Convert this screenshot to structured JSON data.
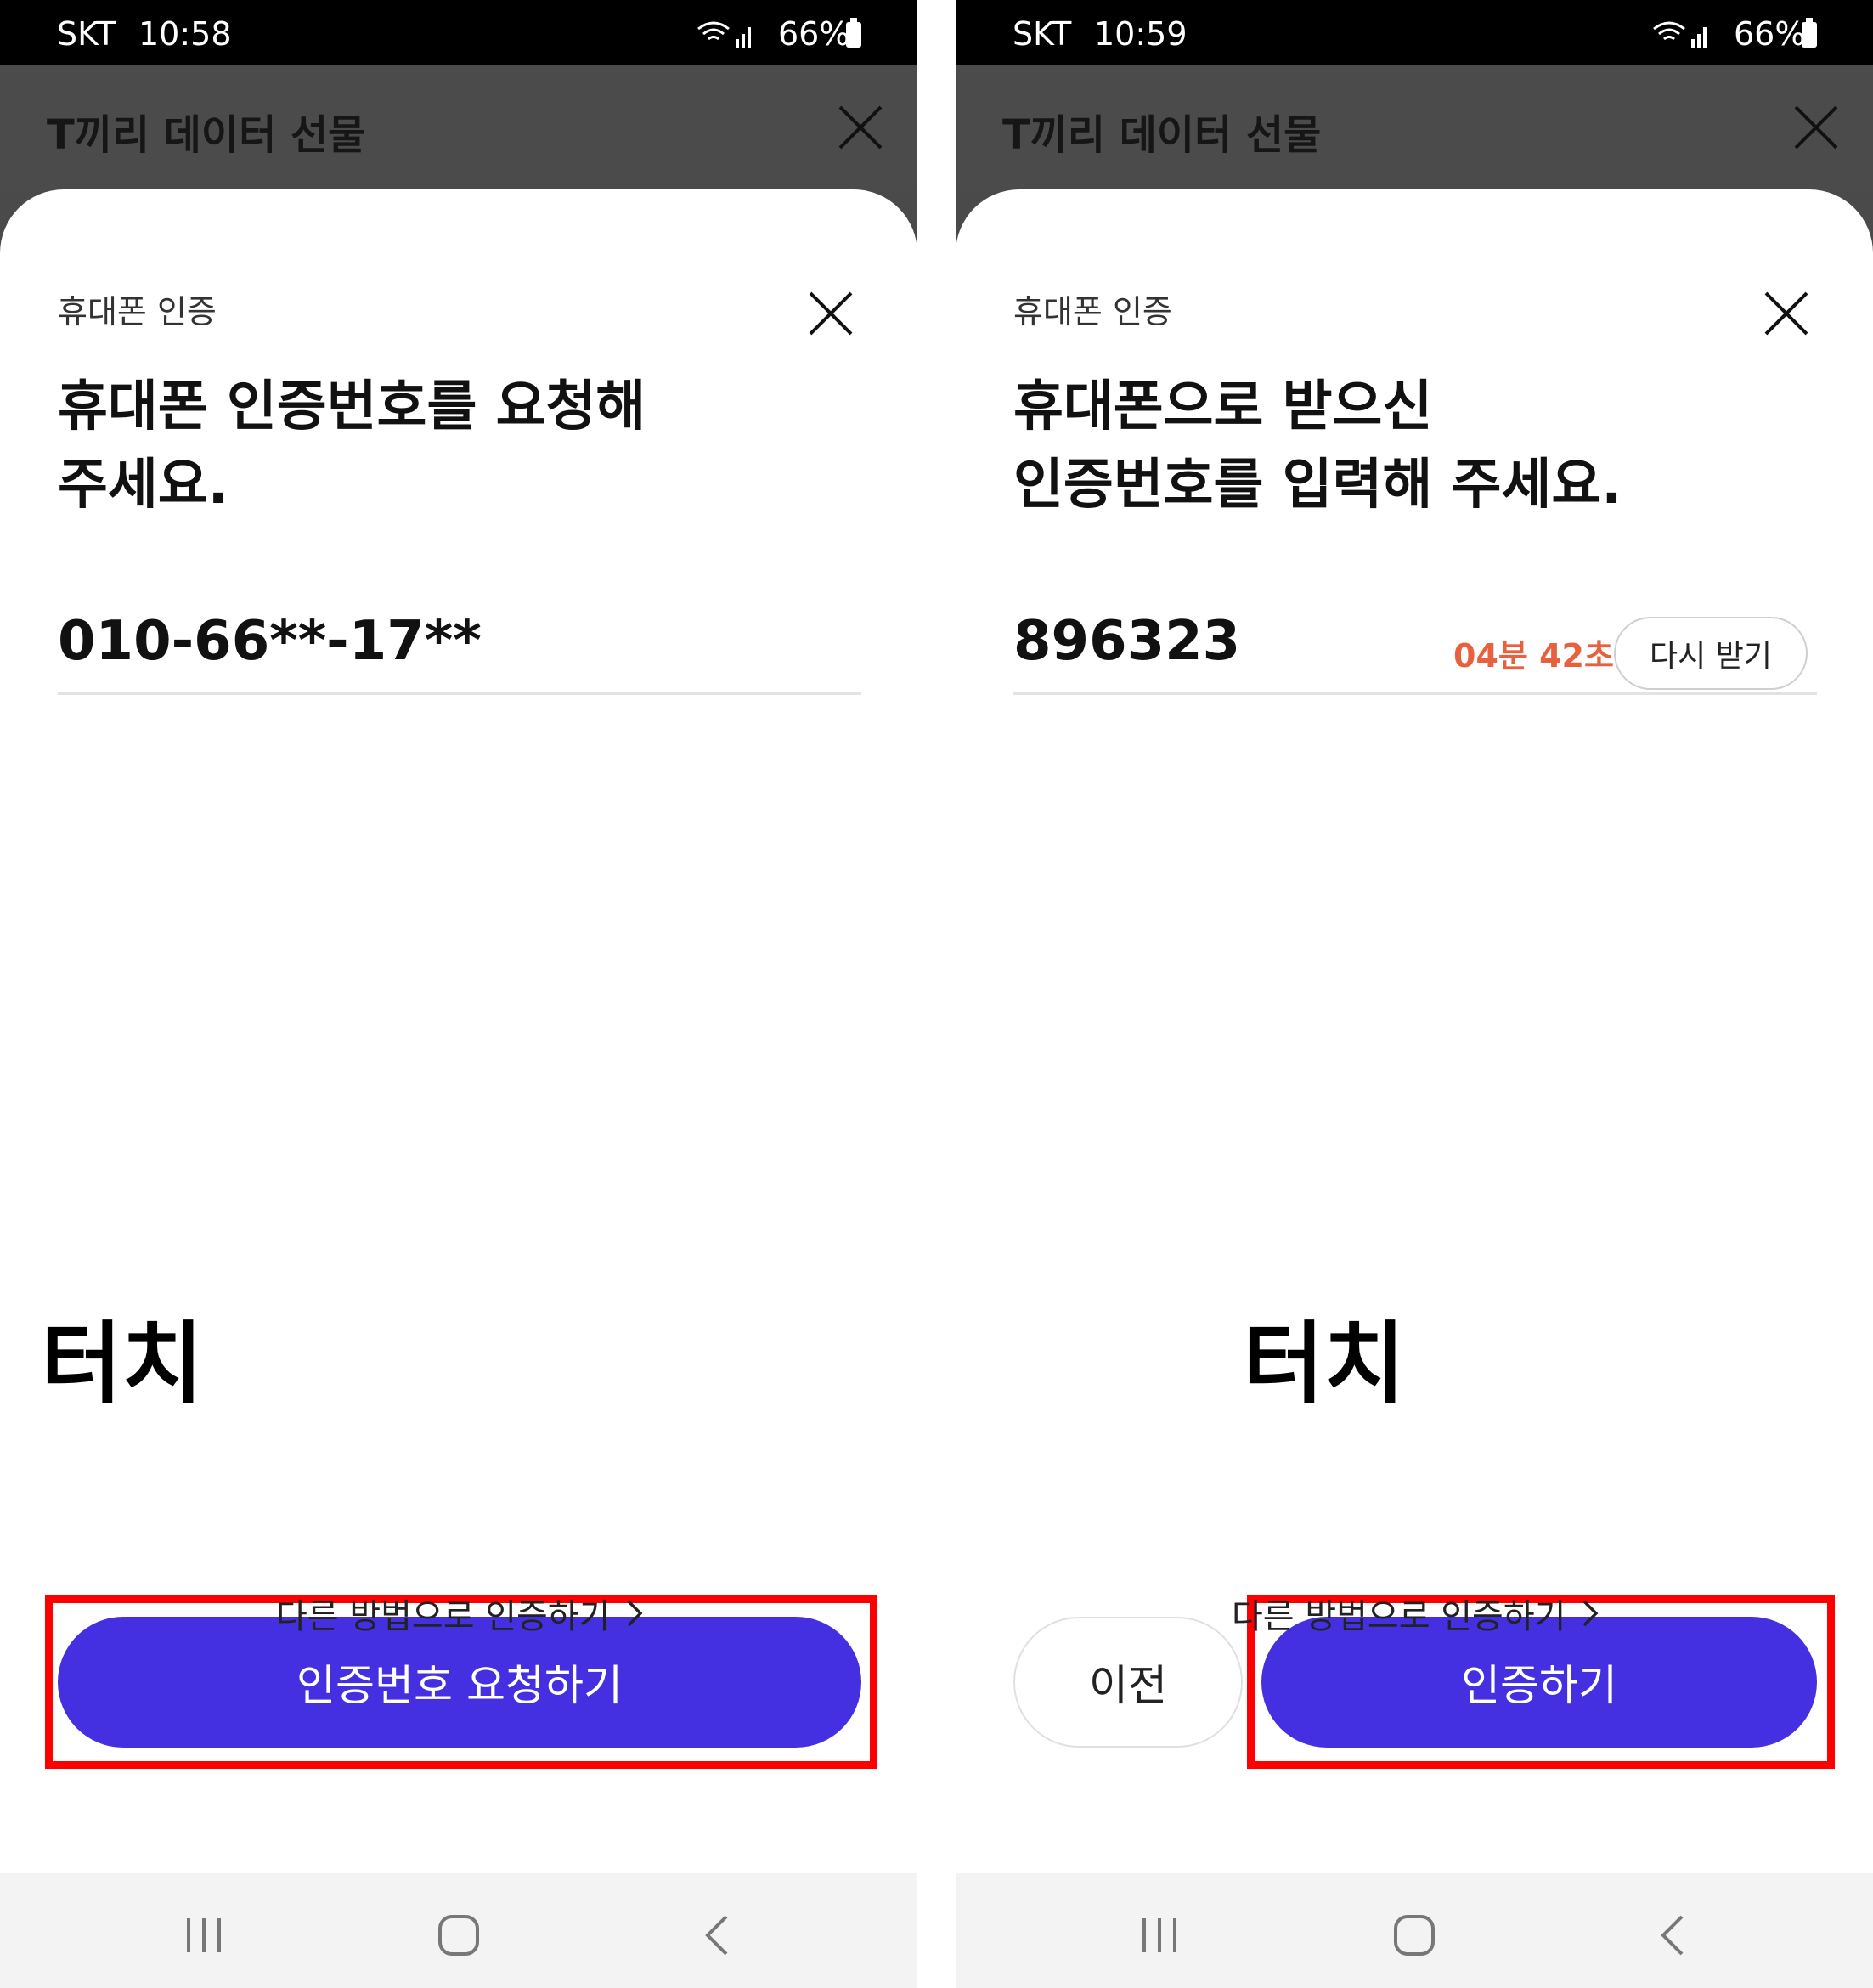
{
  "colors": {
    "primary": "#4430e0",
    "timer": "#e8613f",
    "highlight": "#ff0000",
    "appbar": "#4b4b4b"
  },
  "left": {
    "status": {
      "carrier": "SKT",
      "time": "10:58",
      "battery": "66%"
    },
    "app_title": "T끼리 데이터 선물",
    "sheet_label": "휴대폰 인증",
    "headline_line1": "휴대폰 인증번호를 요청해",
    "headline_line2": "주세요.",
    "input_value": "010-66**-17**",
    "touch_label": "터치",
    "primary_button": "인증번호 요청하기",
    "alt_link": "다른 방법으로 인증하기"
  },
  "right": {
    "status": {
      "carrier": "SKT",
      "time": "10:59",
      "battery": "66%"
    },
    "app_title": "T끼리 데이터 선물",
    "sheet_label": "휴대폰 인증",
    "headline_line1": "휴대폰으로 받으신",
    "headline_line2": "인증번호를 입력해 주세요.",
    "input_value": "896323",
    "timer": "04분 42초",
    "resend_button": "다시 받기",
    "touch_label": "터치",
    "prev_button": "이전",
    "primary_button": "인증하기",
    "alt_link": "다른 방법으로 인증하기"
  },
  "icons": {
    "close": "close-icon",
    "wifi": "wifi-icon",
    "signal": "signal-icon",
    "battery": "battery-icon",
    "recents": "recents-icon",
    "home": "home-icon",
    "back": "back-icon",
    "chevron": "chevron-right-icon"
  }
}
